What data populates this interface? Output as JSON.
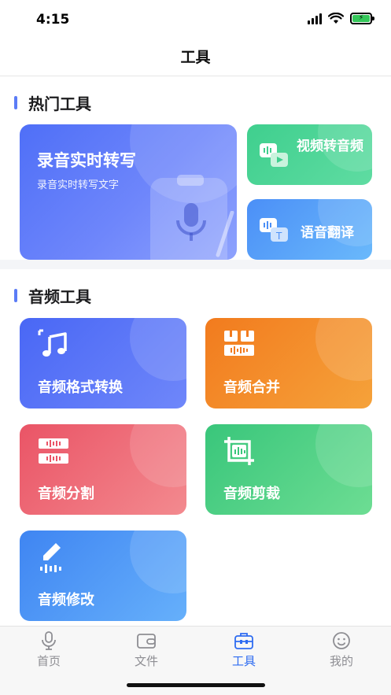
{
  "status_bar": {
    "time": "4:15"
  },
  "nav": {
    "title": "工具"
  },
  "hot_tools": {
    "title": "热门工具",
    "main": {
      "title": "录音实时转写",
      "subtitle": "录音实时转写文字"
    },
    "video_to_audio": {
      "label": "视频转音频"
    },
    "voice_translate": {
      "label": "语音翻译"
    }
  },
  "audio_tools": {
    "title": "音频工具",
    "items": [
      {
        "label": "音频格式转换",
        "icon": "music-note-icon"
      },
      {
        "label": "音频合并",
        "icon": "merge-icon"
      },
      {
        "label": "音频分割",
        "icon": "split-icon"
      },
      {
        "label": "音频剪裁",
        "icon": "crop-icon"
      },
      {
        "label": "音频修改",
        "icon": "edit-pen-icon"
      }
    ]
  },
  "tab_bar": {
    "items": [
      {
        "label": "首页",
        "icon": "microphone-icon"
      },
      {
        "label": "文件",
        "icon": "wallet-icon"
      },
      {
        "label": "工具",
        "icon": "toolbox-icon",
        "active": true
      },
      {
        "label": "我的",
        "icon": "smiley-icon"
      }
    ]
  },
  "colors": {
    "accent": "#2f6cf1",
    "section_bar": "#5b7cf6"
  }
}
